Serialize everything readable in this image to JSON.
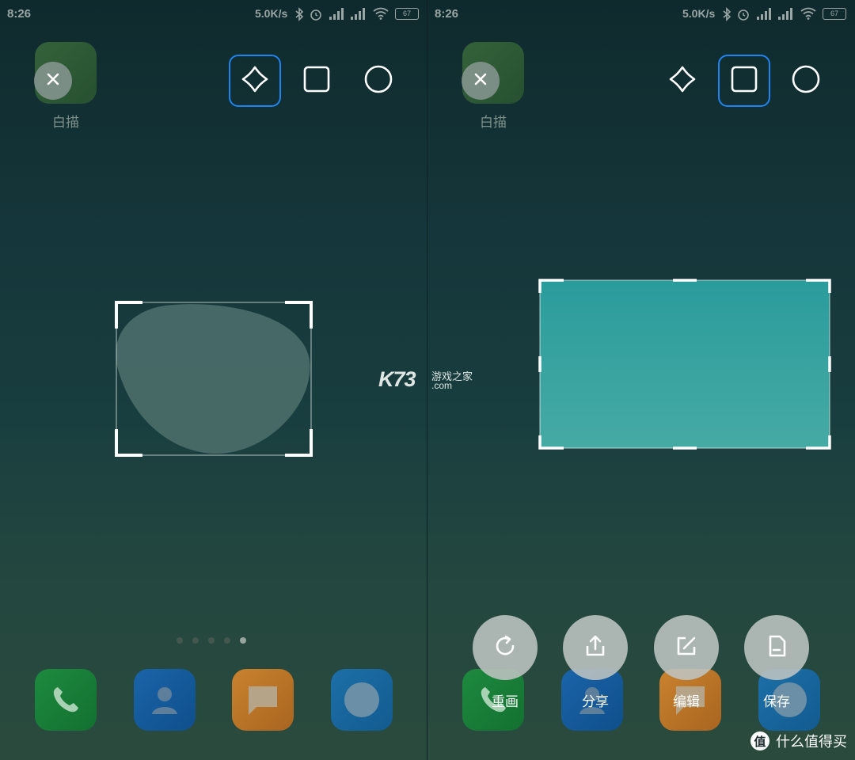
{
  "status": {
    "time": "8:26",
    "net_speed": "5.0K/s",
    "battery": "67"
  },
  "app": {
    "label": "白描"
  },
  "shapes": {
    "left_selected": "freeform",
    "right_selected": "rectangle",
    "options": [
      "freeform-icon",
      "square-icon",
      "circle-icon"
    ]
  },
  "page_indicator": {
    "count": 5,
    "active_index": 4
  },
  "actions": [
    {
      "label": "重画",
      "icon": "redraw-icon"
    },
    {
      "label": "分享",
      "icon": "share-icon"
    },
    {
      "label": "编辑",
      "icon": "edit-icon"
    },
    {
      "label": "保存",
      "icon": "save-icon"
    }
  ],
  "watermark": {
    "brand": "K73",
    "cn": "游戏之家",
    "domain": ".com"
  },
  "credit": {
    "logo": "值",
    "text": "什么值得买"
  },
  "colors": {
    "accent_selected": "#1f84f2",
    "selection_fill": "#36a3a1",
    "freeform_fill": "#4b6e6a"
  }
}
